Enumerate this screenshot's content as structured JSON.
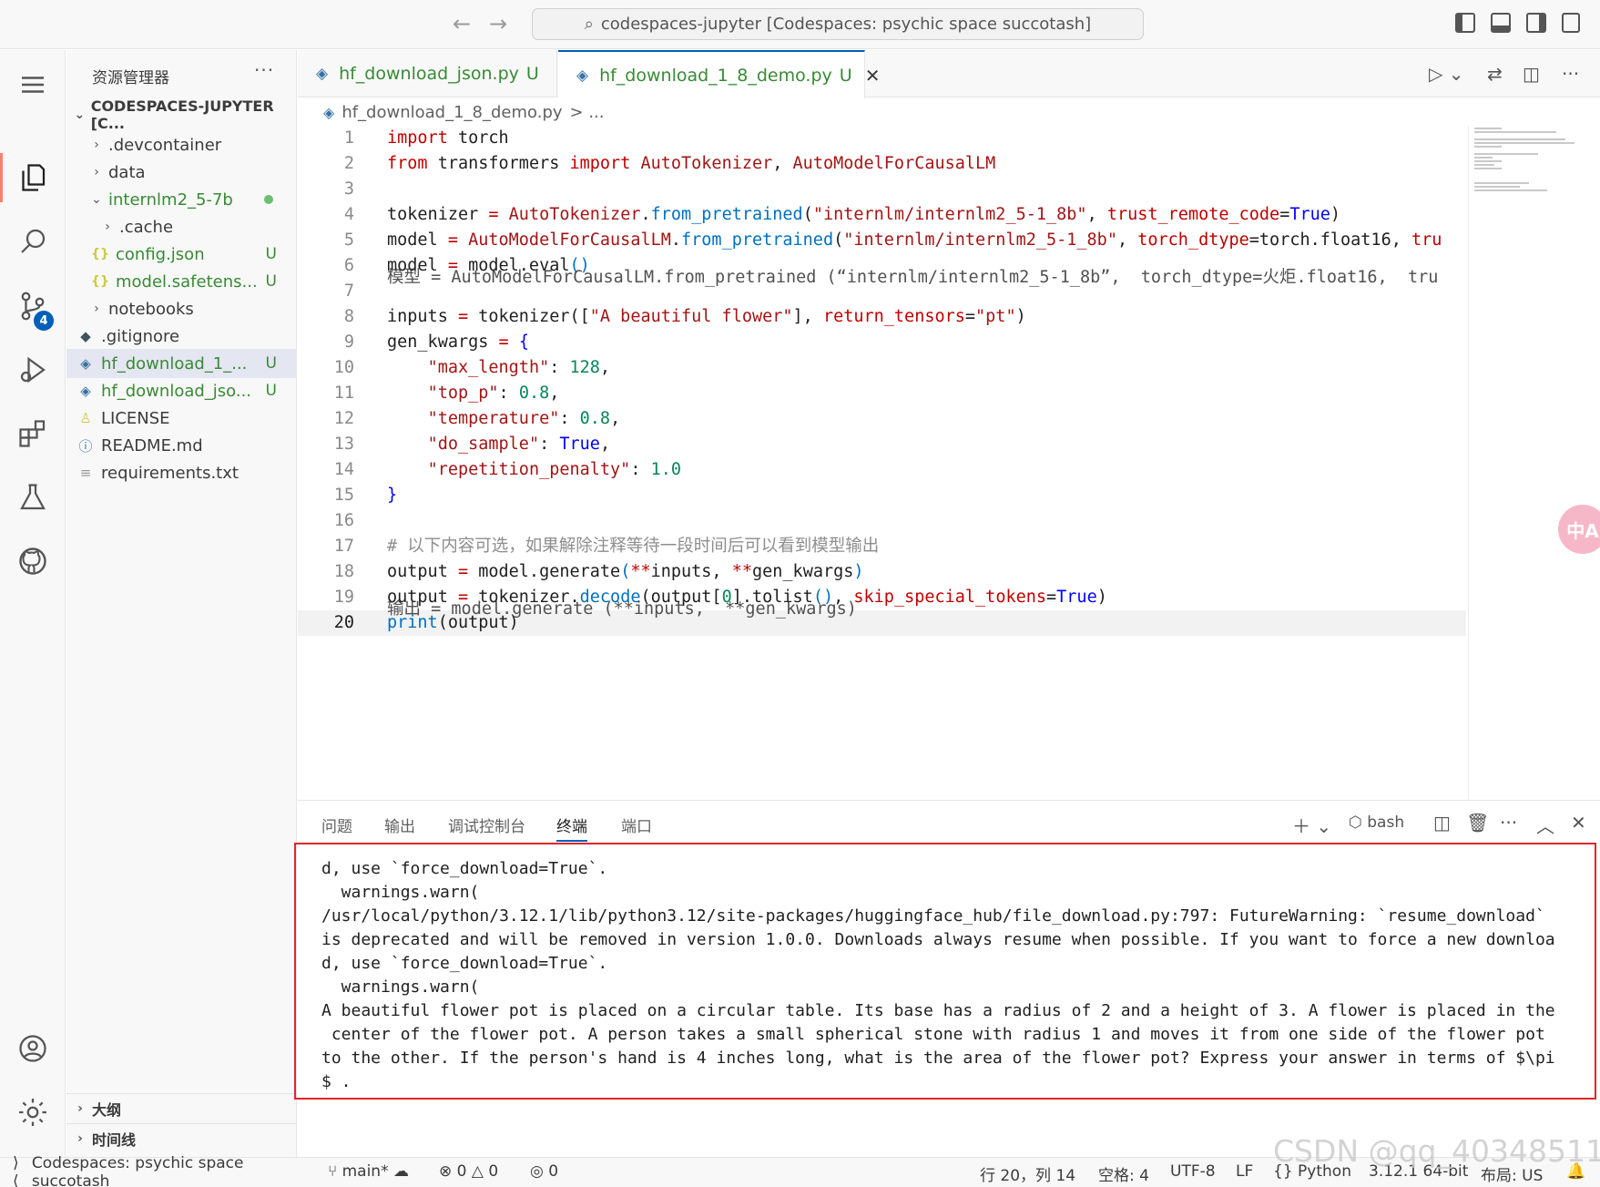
{
  "titlebar": {
    "command_center": "codespaces-jupyter [Codespaces: psychic space succotash]"
  },
  "activitybar": {
    "items": [
      "explorer-icon",
      "search-icon",
      "source-control-icon",
      "run-debug-icon",
      "extensions-icon",
      "testing-icon",
      "github-icon"
    ],
    "scm_badge": "4"
  },
  "sidebar": {
    "title": "资源管理器",
    "more": "···",
    "root": "CODESPACES-JUPYTER [C...",
    "items": [
      {
        "label": ".devcontainer",
        "status": ""
      },
      {
        "label": "data",
        "status": ""
      },
      {
        "label": "internlm2_5-7b",
        "status": ""
      },
      {
        "label": ".cache",
        "status": ""
      },
      {
        "label": "config.json",
        "status": "U"
      },
      {
        "label": "model.safetens...",
        "status": "U"
      },
      {
        "label": "notebooks",
        "status": ""
      },
      {
        "label": ".gitignore",
        "status": ""
      },
      {
        "label": "hf_download_1_...",
        "status": "U"
      },
      {
        "label": "hf_download_jso...",
        "status": "U"
      },
      {
        "label": "LICENSE",
        "status": ""
      },
      {
        "label": "README.md",
        "status": ""
      },
      {
        "label": "requirements.txt",
        "status": ""
      }
    ],
    "outline": "大纲",
    "timeline": "时间线"
  },
  "tabs": [
    {
      "label": "hf_download_json.py",
      "status": "U"
    },
    {
      "label": "hf_download_1_8_demo.py",
      "status": "U"
    }
  ],
  "breadcrumb": {
    "file": "hf_download_1_8_demo.py",
    "rest": "> ..."
  },
  "code": {
    "line_numbers": [
      "1",
      "2",
      "3",
      "4",
      "5",
      "6",
      "7",
      "8",
      "9",
      "10",
      "11",
      "12",
      "13",
      "14",
      "15",
      "16",
      "17",
      "18",
      "19",
      "20"
    ],
    "line17_comment": "# 以下内容可选，如果解除注释等待一段时间后可以看到模型输出",
    "overlay_line6": "模型 = AutoModelForCausalLM.from_pretrained (“internlm/internlm2_5-1_8b”,  torch_dtype=火炬.float16,  tru",
    "overlay_line19": "输出 = model.generate (**inputs,  **gen_kwargs)"
  },
  "panel": {
    "tabs": [
      "问题",
      "输出",
      "调试控制台",
      "终端",
      "端口"
    ],
    "shell": "bash",
    "terminal_lines": [
      "d, use `force_download=True`.",
      "  warnings.warn(",
      "/usr/local/python/3.12.1/lib/python3.12/site-packages/huggingface_hub/file_download.py:797: FutureWarning: `resume_download`",
      "is deprecated and will be removed in version 1.0.0. Downloads always resume when possible. If you want to force a new downloa",
      "d, use `force_download=True`.",
      "  warnings.warn(",
      "A beautiful flower pot is placed on a circular table. Its base has a radius of 2 and a height of 3. A flower is placed in the",
      " center of the flower pot. A person takes a small spherical stone with radius 1 and moves it from one side of the flower pot",
      "to the other. If the person's hand is 4 inches long, what is the area of the flower pot? Express your answer in terms of $\\pi",
      "$ ."
    ]
  },
  "statusbar": {
    "remote": "Codespaces: psychic space succotash",
    "branch": "main*",
    "errors": "0",
    "warnings": "0",
    "ports": "0",
    "position": "行 20，列 14",
    "spaces": "空格: 4",
    "encoding": "UTF-8",
    "eol": "LF",
    "language": "Python",
    "interpreter": "3.12.1 64-bit",
    "layout": "布局: US"
  },
  "watermark": "CSDN @qq_40348511",
  "translate_button": "中A"
}
